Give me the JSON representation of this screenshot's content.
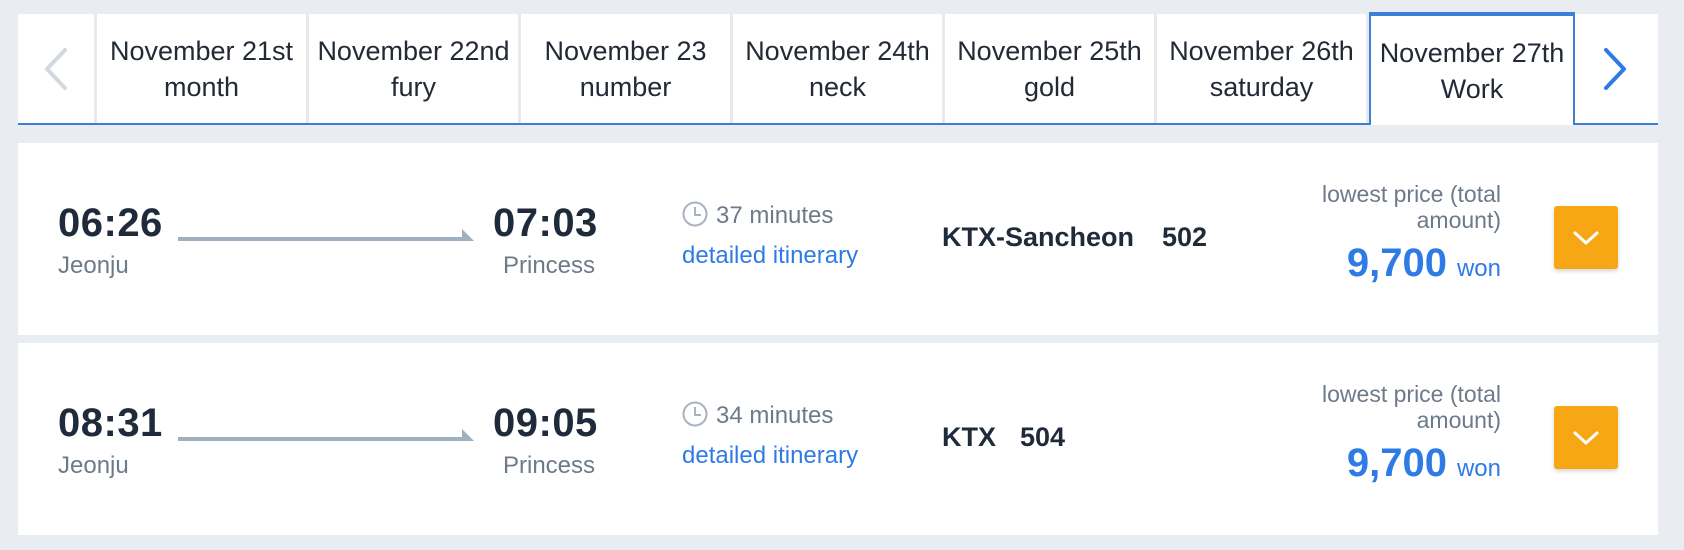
{
  "colors": {
    "accent": "#3d7ed8",
    "link": "#2f7be5",
    "expand_button": "#f8a714",
    "muted_text": "#6d7a8a",
    "page_background": "#e9edf2"
  },
  "date_nav": {
    "prev_icon": "chevron-left-icon",
    "next_icon": "chevron-right-icon",
    "tabs": [
      {
        "date": "November 21st",
        "day": "month"
      },
      {
        "date": "November 22nd",
        "day": "fury"
      },
      {
        "date": "November 23",
        "day": "number"
      },
      {
        "date": "November 24th",
        "day": "neck"
      },
      {
        "date": "November 25th",
        "day": "gold"
      },
      {
        "date": "November 26th",
        "day": "saturday"
      },
      {
        "date": "November 27th",
        "day": "Work"
      }
    ],
    "active_tab": "November 27th"
  },
  "trains": [
    {
      "departure_time": "06:26",
      "departure_station": "Jeonju",
      "arrival_time": "07:03",
      "arrival_station": "Princess",
      "duration_icon": "clock-icon",
      "duration": "37 minutes",
      "itinerary_link": "detailed itinerary",
      "train_name": "KTX-Sancheon",
      "train_number": "502",
      "price_label": "lowest price (total amount)",
      "price": "9,700",
      "price_unit": "won",
      "expand_icon": "chevron-down-icon"
    },
    {
      "departure_time": "08:31",
      "departure_station": "Jeonju",
      "arrival_time": "09:05",
      "arrival_station": "Princess",
      "duration_icon": "clock-icon",
      "duration": "34 minutes",
      "itinerary_link": "detailed itinerary",
      "train_name": "KTX",
      "train_number": "504",
      "price_label": "lowest price (total amount)",
      "price": "9,700",
      "price_unit": "won",
      "expand_icon": "chevron-down-icon"
    }
  ]
}
